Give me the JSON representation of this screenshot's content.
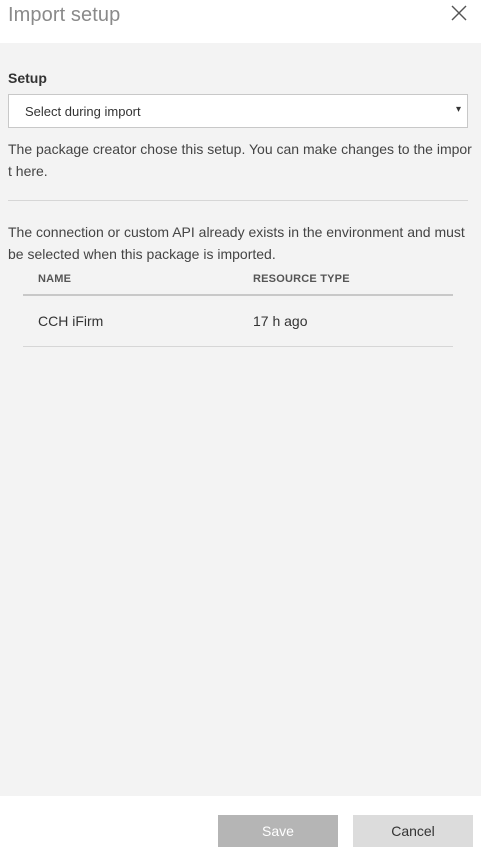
{
  "header": {
    "title": "Import setup",
    "close_icon": "close-icon"
  },
  "setup": {
    "label": "Setup",
    "selected_value": "Select during import",
    "arrow": "▾",
    "help_text": "The package creator chose this setup. You can make changes to the import here."
  },
  "info": {
    "text": "The connection or custom API already exists in the environment and must be selected when this package is imported."
  },
  "table": {
    "headers": {
      "name": "NAME",
      "resource_type": "RESOURCE TYPE"
    },
    "rows": [
      {
        "name": "CCH iFirm",
        "resource_type": "17 h ago"
      }
    ]
  },
  "footer": {
    "save_label": "Save",
    "cancel_label": "Cancel"
  },
  "colors": {
    "panel_bg": "#f3f3f3",
    "disabled_button": "#b5b5b5",
    "secondary_button": "#dcdcdc"
  }
}
